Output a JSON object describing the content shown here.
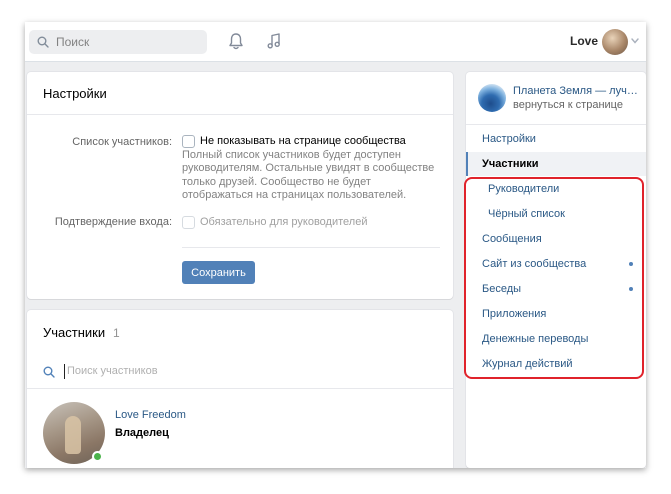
{
  "header": {
    "search_placeholder": "Поиск",
    "user_name": "Love"
  },
  "settings": {
    "title": "Настройки",
    "members_list_label": "Список участников:",
    "hide_members_label": "Не показывать на странице сообщества",
    "hide_members_desc": "Полный список участников будет доступен руководителям. Остальные увидят в сообществе только друзей. Сообщество не будет отображаться на страницах пользователей.",
    "entry_confirm_label": "Подтверждение входа:",
    "entry_confirm_option": "Обязательно для руководителей",
    "save_label": "Сохранить"
  },
  "members": {
    "title": "Участники",
    "count": "1",
    "search_placeholder": "Поиск участников",
    "items": [
      {
        "name": "Love Freedom",
        "role": "Владелец",
        "online": true
      }
    ]
  },
  "sidebar": {
    "group_name": "Планета Земля — лучшие фото",
    "back_link": "вернуться к странице",
    "items": [
      {
        "label": "Настройки"
      },
      {
        "label": "Участники",
        "active": true
      },
      {
        "label": "Руководители",
        "sub": true
      },
      {
        "label": "Чёрный список",
        "sub": true
      },
      {
        "label": "Сообщения"
      },
      {
        "label": "Сайт из сообщества",
        "dot": true
      },
      {
        "label": "Беседы",
        "dot": true
      },
      {
        "label": "Приложения"
      },
      {
        "label": "Денежные переводы"
      },
      {
        "label": "Журнал действий"
      }
    ]
  },
  "colors": {
    "accent": "#5181b8",
    "link": "#2a5885",
    "highlight": "#e0232b",
    "online": "#4bb34b"
  }
}
